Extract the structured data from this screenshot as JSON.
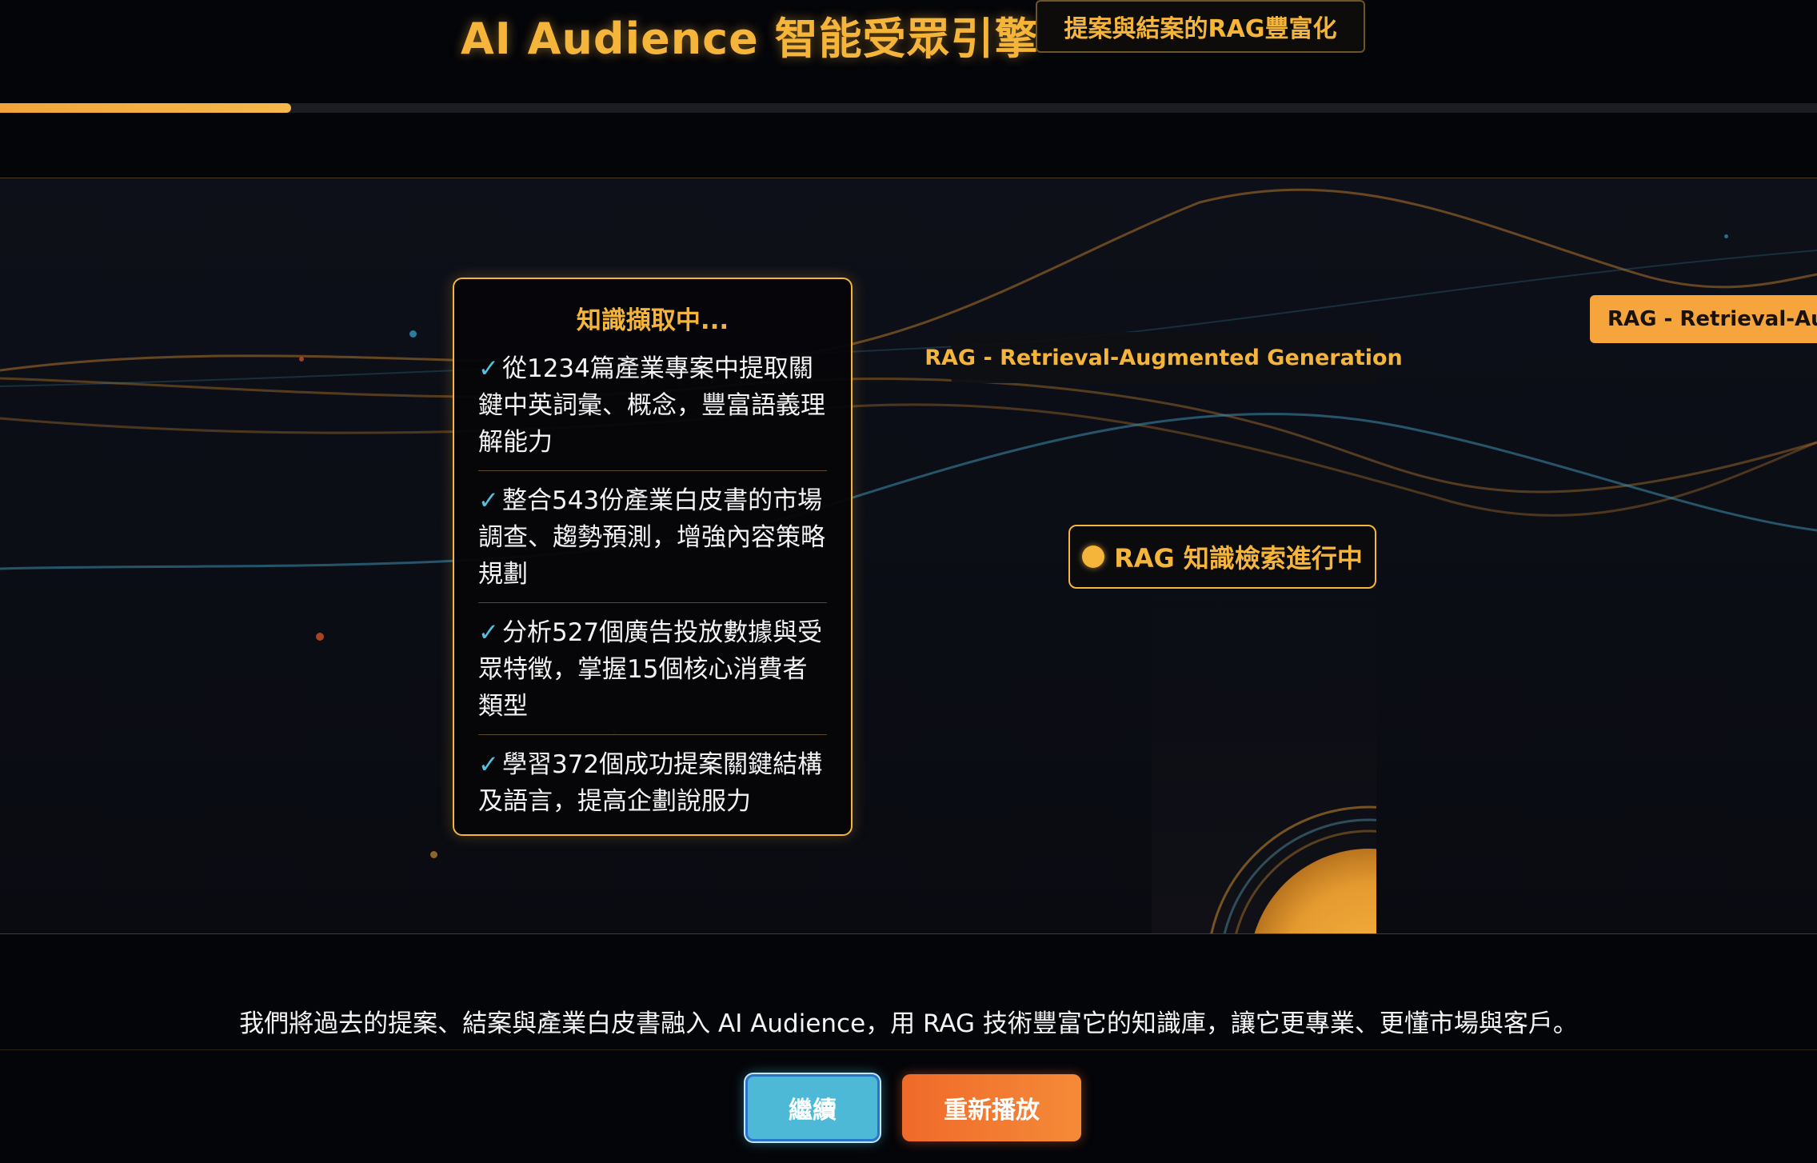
{
  "header": {
    "title": "AI Audience 智能受眾引擎",
    "badge": "提案與結案的RAG豐富化"
  },
  "progress": {
    "fraction": 0.16
  },
  "knowledge_panel": {
    "title": "知識擷取中...",
    "check_symbol": "✓",
    "items": [
      "從1234篇產業專案中提取關鍵中英詞彙、概念，豐富語義理解能力",
      "整合543份產業白皮書的市場調查、趨勢預測，增強內容策略規劃",
      "分析527個廣告投放數據與受眾特徵，掌握15個核心消費者類型",
      "學習372個成功提案關鍵結構及語言，提高企劃說服力"
    ]
  },
  "rag_label": "RAG - Retrieval-Augmented Generation",
  "rag_tag": "RAG - Retrieval-Augmented Generation",
  "status": {
    "text": "RAG 知識檢索進行中"
  },
  "description": "我們將過去的提案、結案與產業白皮書融入 AI Audience，用 RAG 技術豐富它的知識庫，讓它更專業、更懂市場與客戶。",
  "buttons": {
    "continue": "繼續",
    "replay": "重新播放"
  },
  "colors": {
    "accent": "#f5b43a",
    "check": "#4fc3e0",
    "continue_button": "#4db9d6",
    "replay_button": "#f06a2a"
  }
}
